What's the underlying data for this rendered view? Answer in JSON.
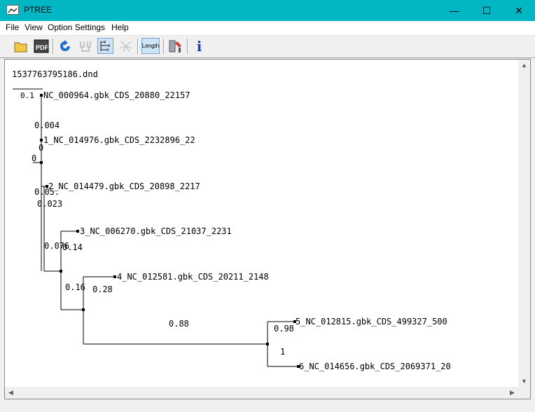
{
  "window": {
    "title": "PTREE",
    "minimize": "—",
    "maximize": "☐",
    "close": "✕"
  },
  "menu": [
    "File",
    "View",
    "Option Settings",
    "Help"
  ],
  "toolbar": {
    "open": "open-folder-icon",
    "pdf_label": "PDF",
    "refresh": "refresh-icon",
    "tree": "tree-icon",
    "rect_tree": "rectangular-tree-icon",
    "radial": "radial-tree-icon",
    "length_label": "Length",
    "settings": "settings-icon",
    "info_label": "i"
  },
  "tree": {
    "filename": "1537763795186.dnd",
    "scale_label": "0.1",
    "leaves": [
      "NC_000964.gbk_CDS_20880_22157",
      "1_NC_014976.gbk_CDS_2232896_22",
      "2_NC_014479.gbk_CDS_20898_2217",
      "3_NC_006270.gbk_CDS_21037_2231",
      "4_NC_012581.gbk_CDS_20211_2148",
      "5_NC_012815.gbk_CDS_499327_500",
      "6_NC_014656.gbk_CDS_2069371_20"
    ],
    "branch_labels": [
      "0.004",
      "0",
      "0",
      "0.05.",
      "0.023",
      "0.076",
      "0.14",
      "0.16",
      "0.28",
      "0.88",
      "0.98",
      "1"
    ]
  },
  "scroll": {
    "up": "▲",
    "down": "▼",
    "left": "◀",
    "right": "▶"
  }
}
